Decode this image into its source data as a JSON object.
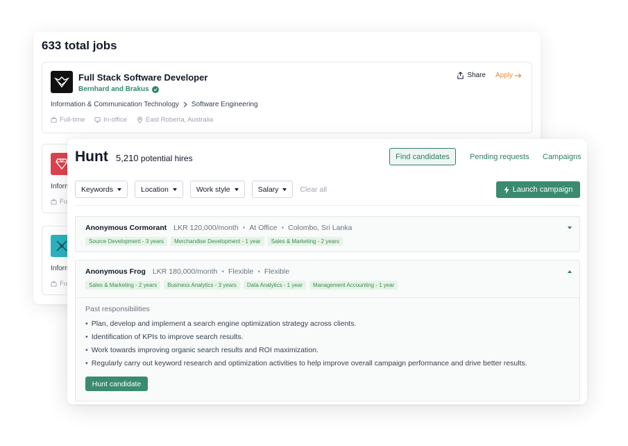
{
  "jobs": {
    "total_label": "633 total jobs",
    "featured": {
      "title": "Full Stack Software Developer",
      "company": "Bernhard and Brakus",
      "share_label": "Share",
      "apply_label": "Apply",
      "category": "Information & Communication Technology",
      "subcategory": "Software Engineering",
      "employment_type": "Full-time",
      "work_mode": "In-office",
      "location": "East Roberta, Australia"
    },
    "peek_text": "Inform",
    "peek_meta": "Fu"
  },
  "hunt": {
    "title": "Hunt",
    "count": "5,210",
    "count_label": "potential hires",
    "nav": {
      "find": "Find candidates",
      "pending": "Pending requests",
      "campaigns": "Campaigns"
    },
    "filters": {
      "keywords": "Keywords",
      "location": "Location",
      "work_style": "Work style",
      "salary": "Salary",
      "clear_all": "Clear all"
    },
    "launch_label": "Launch campaign",
    "candidates": [
      {
        "name": "Anonymous Cormorant",
        "salary": "LKR 120,000/month",
        "work_style": "At Office",
        "location": "Colombo, Sri Lanka",
        "tags": [
          "Source Development - 3 years",
          "Merchandise Development - 1 year",
          "Sales & Marketing - 2 years"
        ]
      },
      {
        "name": "Anonymous Frog",
        "salary": "LKR 180,000/month",
        "work_style": "Flexible",
        "location": "Flexible",
        "tags": [
          "Sales & Marketing - 2 years",
          "Business Analytics - 3 years",
          "Data Analytics - 1 year",
          "Management Accounting - 1 year"
        ],
        "responsibilities_title": "Past responsibilities",
        "responsibilities": [
          "Plan, develop and implement a search engine optimization strategy across clients.",
          "Identification of KPIs to improve search results.",
          "Work towards improving organic search results and ROI maximization.",
          "Regularly carry out keyword research and optimization activities to help improve overall campaign performance and drive better results."
        ],
        "action_label": "Hunt candidate"
      }
    ]
  },
  "colors": {
    "accent": "#3a8b6f",
    "apply": "#e98b45",
    "tag_bg": "#e6f4e8",
    "tag_text": "#3f8a4e"
  }
}
